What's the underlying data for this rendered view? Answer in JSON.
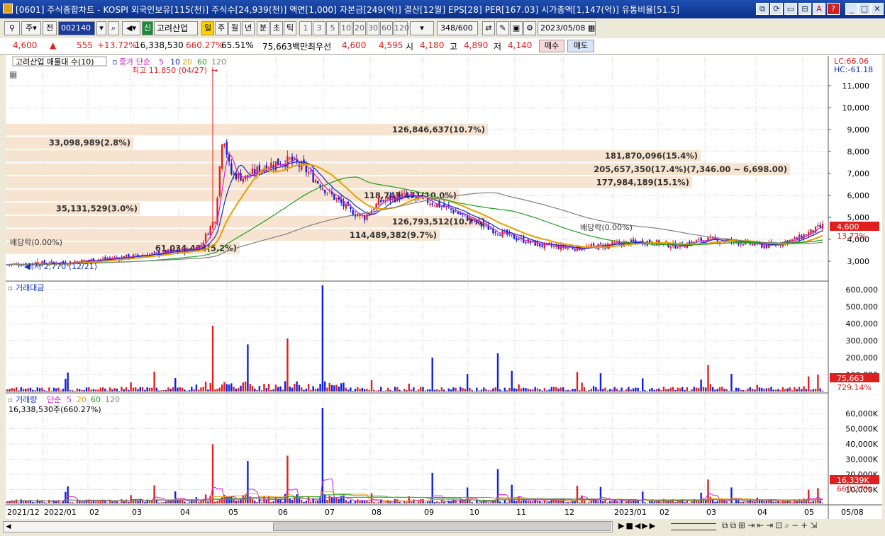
{
  "window": {
    "title": "[0601] 주식종합차트 - KOSPI 외국인보유[115(천)] 주식수[24,939(천)] 액면[1,000] 자본금[249(억)] 결산[12월] EPS[28] PER[167.03] 시가총액[1,147(억)] 유통비율[51.5]"
  },
  "toolbar": {
    "market_select": "주",
    "prev_label": "전",
    "stock_code": "002140",
    "stock_name": "고려산업",
    "new_badge": "신",
    "period_buttons": [
      "일",
      "주",
      "월",
      "년",
      "분",
      "초",
      "틱"
    ],
    "active_period": "일",
    "interval_buttons": [
      "1",
      "3",
      "5",
      "10",
      "20",
      "30",
      "60",
      "120"
    ],
    "count": "348",
    "count_total": "/600",
    "date": "2023/05/08"
  },
  "ticker": {
    "price": "4,600",
    "change_arrow": "▲",
    "change": "555",
    "change_pct": "+13.72%",
    "volume": "16,338,530",
    "volume_ratio": "660.27%",
    "turnover_pct": "65.51%",
    "trade_value": "75,663백만",
    "best_label": "최우선",
    "best_ask": "4,600",
    "best_bid": "4,595",
    "open_label": "시",
    "open": "4,180",
    "high_label": "고",
    "high": "4,890",
    "low_label": "저",
    "low": "4,140",
    "buy_button": "매수",
    "sell_button": "매도"
  },
  "price_panel": {
    "title": "고려산업 매물대 수(10)",
    "ma_label": "종가 단순",
    "ma_periods": [
      "5",
      "10",
      "20",
      "60",
      "120"
    ],
    "lc": "LC:66.06",
    "hc": "HC:-61.18",
    "high_note": "최고 11,850 (04/27)",
    "low_note": "최저 2,770 (12/21)",
    "dividend_label": "배당락(0.00%)",
    "current_price_tag": "4,600",
    "current_pct_tag": "13.72%",
    "y_ticks": [
      "11,000",
      "10,000",
      "9,000",
      "8,000",
      "7,000",
      "6,000",
      "5,000",
      "4,000",
      "3,000"
    ],
    "volume_profile": [
      "126,846,637(10.7%)",
      "33,098,989(2.8%)",
      "181,870,096(15.4%)",
      "205,657,350(17.4%)(7,346.00 ~ 6,698.00)",
      "177,984,189(15.1%)",
      "118,747,471(10.0%)",
      "35,131,529(3.0%)",
      "126,793,512(10.7%)",
      "114,489,382(9.7%)",
      "61,034,434(5.2%)"
    ]
  },
  "value_panel": {
    "title": "거래대금",
    "y_ticks": [
      "600,000",
      "500,000",
      "400,000",
      "300,000",
      "200,000",
      "100,000"
    ],
    "current_tag": "75,663",
    "pct_tag": "729.14%"
  },
  "volume_panel": {
    "title": "거래량",
    "ma_label": "단순",
    "ma_periods": [
      "5",
      "20",
      "60",
      "120"
    ],
    "current_text": "16,338,530주(660.27%)",
    "y_ticks": [
      "60,000K",
      "50,000K",
      "40,000K",
      "30,000K",
      "20,000K",
      "10,000K"
    ],
    "current_tag": "16,339K",
    "pct_tag": "660.27%"
  },
  "x_axis": [
    "2021/12",
    "2022/01",
    "02",
    "03",
    "04",
    "05",
    "06",
    "07",
    "08",
    "09",
    "10",
    "11",
    "12",
    "2023/01",
    "02",
    "03",
    "04",
    "05",
    "05/08"
  ],
  "colors": {
    "up": "#e02020",
    "down": "#1020e0",
    "ma5": "#d020d0",
    "ma10": "#1030c0",
    "ma20": "#e8a000",
    "ma60": "#20a020",
    "ma120": "#808080",
    "profile": "#f6e4d0",
    "title_blue": "#0a2f8a"
  }
}
